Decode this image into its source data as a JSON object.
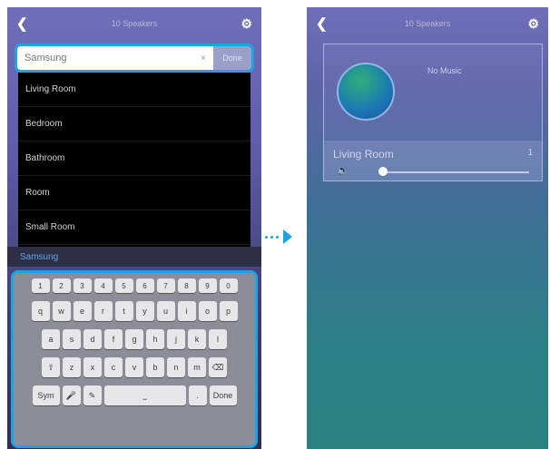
{
  "left_screen": {
    "title": "10 Speakers",
    "search": {
      "value": "Samsung",
      "clear_icon": "×",
      "button_label": "Done"
    },
    "dropdown_items": [
      {
        "label": "Living Room"
      },
      {
        "label": "Bedroom"
      },
      {
        "label": "Bathroom"
      },
      {
        "label": "Room"
      },
      {
        "label": "Small Room"
      }
    ],
    "suggestion": "Samsung",
    "keyboard": {
      "numbers": [
        "1",
        "2",
        "3",
        "4",
        "5",
        "6",
        "7",
        "8",
        "9",
        "0"
      ],
      "row1": [
        "q",
        "w",
        "e",
        "r",
        "t",
        "y",
        "u",
        "i",
        "o",
        "p"
      ],
      "row2": [
        "a",
        "s",
        "d",
        "f",
        "g",
        "h",
        "j",
        "k",
        "l"
      ],
      "row3": [
        "⇧",
        "z",
        "x",
        "c",
        "v",
        "b",
        "n",
        "m",
        "⌫"
      ],
      "bottom": {
        "sym": "Sym",
        "mic": "🎤",
        "pen": "✎",
        "space": "⎵",
        "dot": ".",
        "done": "Done"
      }
    }
  },
  "right_screen": {
    "title": "10 Speakers",
    "now_playing": "No Music",
    "zone": {
      "name": "Living Room",
      "count": "1"
    },
    "volume_level": 0.0
  },
  "colors": {
    "accent": "#1fa3e2",
    "header": "#6f6fb9"
  },
  "icons": {
    "back": "back-icon",
    "settings": "gear-icon",
    "speaker": "speaker-icon"
  }
}
